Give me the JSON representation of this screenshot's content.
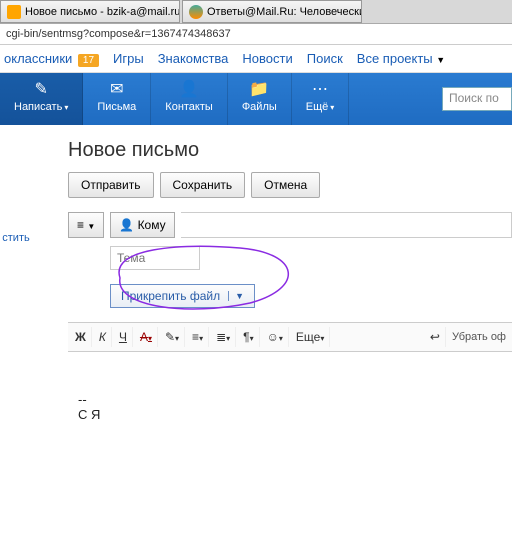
{
  "tabs": [
    {
      "title": "Новое письмо - bzik-a@mail.ru - Почта ..."
    },
    {
      "title": "Ответы@Mail.Ru: Человеческий поиск..."
    }
  ],
  "url": "cgi-bin/sentmsg?compose&r=1367474348637",
  "portal": {
    "odnoklassniki": "оклассники",
    "badge": "17",
    "games": "Игры",
    "dating": "Знакомства",
    "news": "Новости",
    "search": "Поиск",
    "projects": "Все проекты"
  },
  "toolbar": {
    "compose": "Написать",
    "letters": "Письма",
    "contacts": "Контакты",
    "files": "Файлы",
    "more": "Ещё",
    "search_placeholder": "Поиск по"
  },
  "sidebar": {
    "cancel": "стить"
  },
  "page_title": "Новое письмо",
  "buttons": {
    "send": "Отправить",
    "save": "Сохранить",
    "cancel": "Отмена"
  },
  "to_label": "Кому",
  "subject_placeholder": "Тема",
  "attach_label": "Прикрепить файл",
  "editor": {
    "bold": "Ж",
    "italic": "К",
    "underline": "Ч",
    "color": "А",
    "more": "Еще",
    "undo": "Убрать оф"
  },
  "body_text": "--\nС Я"
}
